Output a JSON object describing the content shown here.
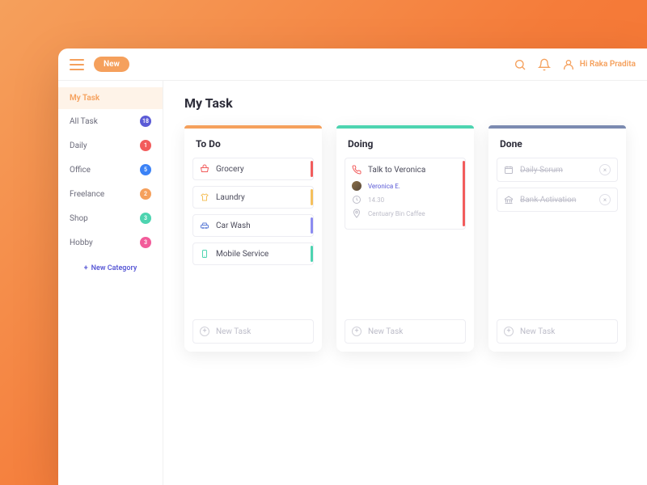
{
  "topbar": {
    "new_button": "New",
    "greeting": "Hi Raka Pradita"
  },
  "sidebar": {
    "items": [
      {
        "label": "My Task",
        "badge": null,
        "active": true
      },
      {
        "label": "All Task",
        "badge": "18",
        "badge_color": "#5b5bd6"
      },
      {
        "label": "Daily",
        "badge": "1",
        "badge_color": "#f25c5c"
      },
      {
        "label": "Office",
        "badge": "5",
        "badge_color": "#3b82f6"
      },
      {
        "label": "Freelance",
        "badge": "2",
        "badge_color": "#f5a05c"
      },
      {
        "label": "Shop",
        "badge": "3",
        "badge_color": "#4dd4b0"
      },
      {
        "label": "Hobby",
        "badge": "3",
        "badge_color": "#f25c9a"
      }
    ],
    "new_category": "New Category"
  },
  "page": {
    "title": "My Task",
    "new_task_label": "New Task"
  },
  "boards": {
    "todo": {
      "title": "To Do",
      "accent": "#f5a05c",
      "tasks": [
        {
          "label": "Grocery",
          "icon_color": "#f25c5c",
          "accent": "#f25c5c"
        },
        {
          "label": "Laundry",
          "icon_color": "#f5c05c",
          "accent": "#f5c05c"
        },
        {
          "label": "Car Wash",
          "icon_color": "#5b7bd6",
          "accent": "#8b8bf0"
        },
        {
          "label": "Mobile Service",
          "icon_color": "#4dd4b0",
          "accent": "#4dd4b0"
        }
      ]
    },
    "doing": {
      "title": "Doing",
      "accent": "#4dd4b0",
      "tasks": [
        {
          "label": "Talk to Veronica",
          "icon_color": "#f25c5c",
          "accent": "#f25c5c",
          "person": "Veronica E.",
          "time": "14.30",
          "location": "Centuary Bin Caffee"
        }
      ]
    },
    "done": {
      "title": "Done",
      "accent": "#7b8ab0",
      "tasks": [
        {
          "label": "Daily Scrum"
        },
        {
          "label": "Bank Activation"
        }
      ]
    }
  }
}
